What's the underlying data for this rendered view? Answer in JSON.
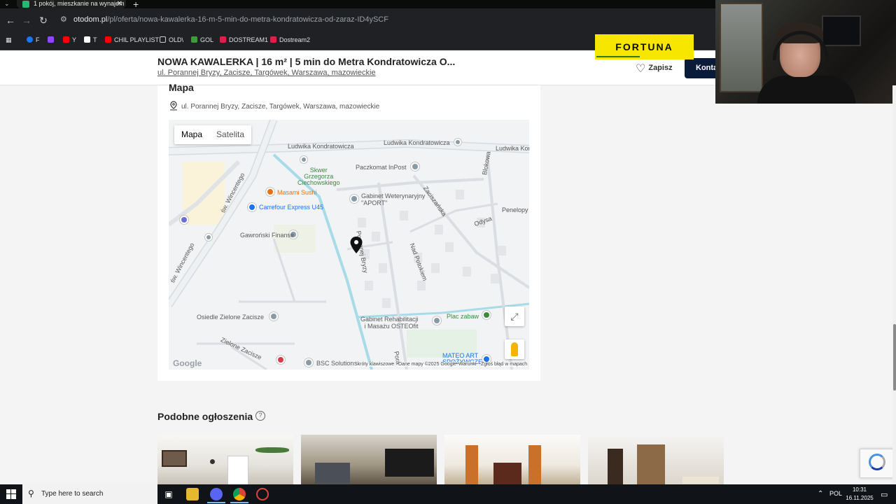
{
  "browser": {
    "tab_title": "1 pokój, mieszkanie na wynajem",
    "url_domain": "otodom.pl",
    "url_path": "/pl/oferta/nowa-kawalerka-16-m-5-min-do-metra-kondratowicza-od-zaraz-ID4ySCF",
    "bookmarks": [
      {
        "label": "F",
        "color": "#1877f2"
      },
      {
        "label": "",
        "color": "#9146ff"
      },
      {
        "label": "Y",
        "color": "#ff0000"
      },
      {
        "label": "T",
        "color": "#ffffff"
      },
      {
        "label": "CHIL PLAYLIST",
        "color": "#ff0000"
      },
      {
        "label": "OLD\\",
        "color": "#ffd23f"
      },
      {
        "label": "GOL",
        "color": "#3c9c3c"
      },
      {
        "label": "DOSTREAM1",
        "color": "#e01e4a"
      },
      {
        "label": "Dostream2",
        "color": "#e01e4a"
      }
    ]
  },
  "listing": {
    "title": "NOWA KAWALERKA | 16 m² | 5 min do Metra Kondratowicza O...",
    "address": "ul. Porannej Bryzy, Zacisze, Targówek, Warszawa, mazowieckie",
    "save_label": "Zapisz",
    "contact_label": "Konta"
  },
  "ad": {
    "brand": "FORTUNA"
  },
  "map_section": {
    "heading": "Mapa",
    "location": "ul. Porannej Bryzy, Zacisze, Targówek, Warszawa, mazowieckie",
    "tabs": [
      "Mapa",
      "Satelita"
    ],
    "active_tab": "Mapa",
    "labels": {
      "road1": "Ludwika Kondratowicza",
      "road2": "Ludwika Kondratowicza",
      "road3": "Ludwika Kondratowicza",
      "park_name": "Skwer\nGrzegorza\nCiechowskiego",
      "parcel": "Paczkomat InPost",
      "sushi": "Masami Sushi",
      "vet": "Gabinet Weterynaryjny\n\"APORT\"",
      "zaciszanska": "Zaciszańska",
      "blokowa": "Blokowa",
      "penelopy": "Penelopy",
      "odysa": "Odysa",
      "carrefour": "Carrefour Express U45",
      "wincentego1": "św. Wincentego",
      "wincentego2": "św. Wincentego",
      "gawronski": "Gawroński Finanse",
      "porannej": "Porannej Bryzy",
      "nad_potokiem": "Nad Potokiem",
      "osiedle": "Osiedle Zielone Zacisze",
      "rehab": "Gabinet Rehabilitacji\ni Masażu OSTEOfit",
      "plac": "Plac zabaw",
      "zielone": "Zielone Zacisze",
      "bsc": "BSC Solutions",
      "mateo": "MATEO ART\nSPOŻYWCZE",
      "porannej2": "Pora"
    },
    "google": "Google",
    "attribution": [
      "Skróty klawiszowe",
      "Dane mapy ©2025 Google",
      "Warunki",
      "Zgłoś błąd w mapach"
    ]
  },
  "similar": {
    "heading": "Podobne ogłoszenia",
    "help": "?"
  },
  "taskbar": {
    "search_placeholder": "Type here to search",
    "lang": "POL",
    "time": "10:31",
    "date": "16.11.2025"
  }
}
